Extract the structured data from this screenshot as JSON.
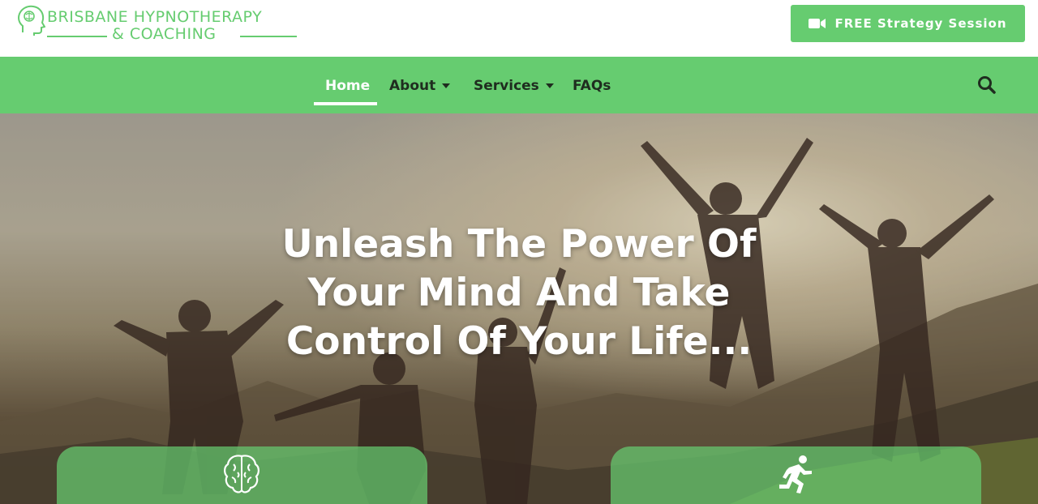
{
  "header": {
    "logo": {
      "line1": "BRISBANE HYPNOTHERAPY",
      "line2": "& COACHING",
      "icon": "head-brain-icon"
    },
    "cta": {
      "label": "FREE Strategy Session",
      "icon": "video-camera-icon"
    }
  },
  "nav": {
    "items": [
      {
        "label": "Home",
        "active": true,
        "has_dropdown": false
      },
      {
        "label": "About",
        "active": false,
        "has_dropdown": true
      },
      {
        "label": "Services",
        "active": false,
        "has_dropdown": true
      },
      {
        "label": "FAQs",
        "active": false,
        "has_dropdown": false
      }
    ],
    "search_icon": "search-icon"
  },
  "hero": {
    "title_lines": [
      "Unleash The Power Of",
      "Your Mind And Take",
      "Control Of Your Life..."
    ],
    "cards": [
      {
        "icon": "brain-icon"
      },
      {
        "icon": "running-person-icon"
      }
    ]
  },
  "colors": {
    "brand_green": "#66cc70",
    "nav_text": "#1f2d1f",
    "white": "#ffffff"
  }
}
